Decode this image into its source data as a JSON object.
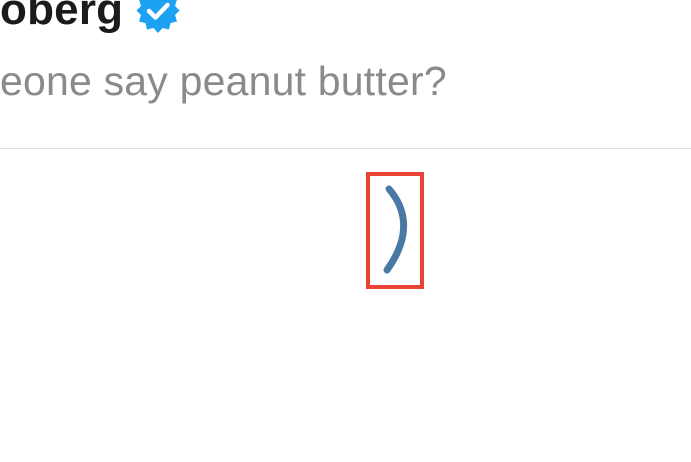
{
  "post": {
    "author_fragment": "oberg",
    "text_fragment": "eone say peanut butter?"
  },
  "icons": {
    "verified": "verified-badge-icon",
    "partial_glyph": "close-parenthesis-icon"
  },
  "colors": {
    "author_text": "#1b1b1b",
    "post_text": "#8a8a8a",
    "divider": "#dedede",
    "verified_badge": "#1da1f2",
    "glyph": "#4a79a4",
    "highlight_border": "#ea4335",
    "background": "#ffffff"
  }
}
